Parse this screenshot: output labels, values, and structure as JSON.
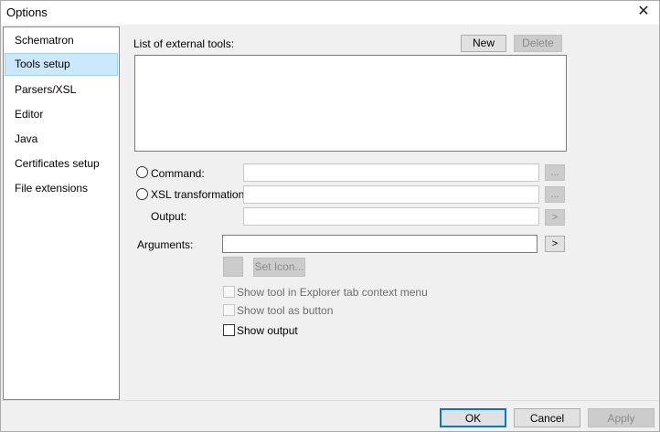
{
  "window": {
    "title": "Options",
    "close_glyph": "✕"
  },
  "sidebar": {
    "items": [
      {
        "label": "Schematron"
      },
      {
        "label": "Tools setup"
      },
      {
        "label": "Parsers/XSL"
      },
      {
        "label": "Editor"
      },
      {
        "label": "Java"
      },
      {
        "label": "Certificates setup"
      },
      {
        "label": "File extensions"
      }
    ],
    "selected": "Tools setup"
  },
  "tools": {
    "list_label": "List of external tools:",
    "new_label": "New",
    "delete_label": "Delete",
    "command_label": "Command:",
    "command_value": "",
    "command_browse": "...",
    "xsl_label": "XSL transformation:",
    "xsl_value": "",
    "xsl_browse": "...",
    "output_label": "Output:",
    "output_value": "",
    "output_arrow": ">",
    "arguments_label": "Arguments:",
    "arguments_value": "",
    "arguments_arrow": ">",
    "set_icon_label": "Set Icon...",
    "show_explorer_label": "Show tool in Explorer tab context menu",
    "show_button_label": "Show tool as button",
    "show_output_label": "Show output"
  },
  "footer": {
    "ok": "OK",
    "cancel": "Cancel",
    "apply": "Apply"
  }
}
